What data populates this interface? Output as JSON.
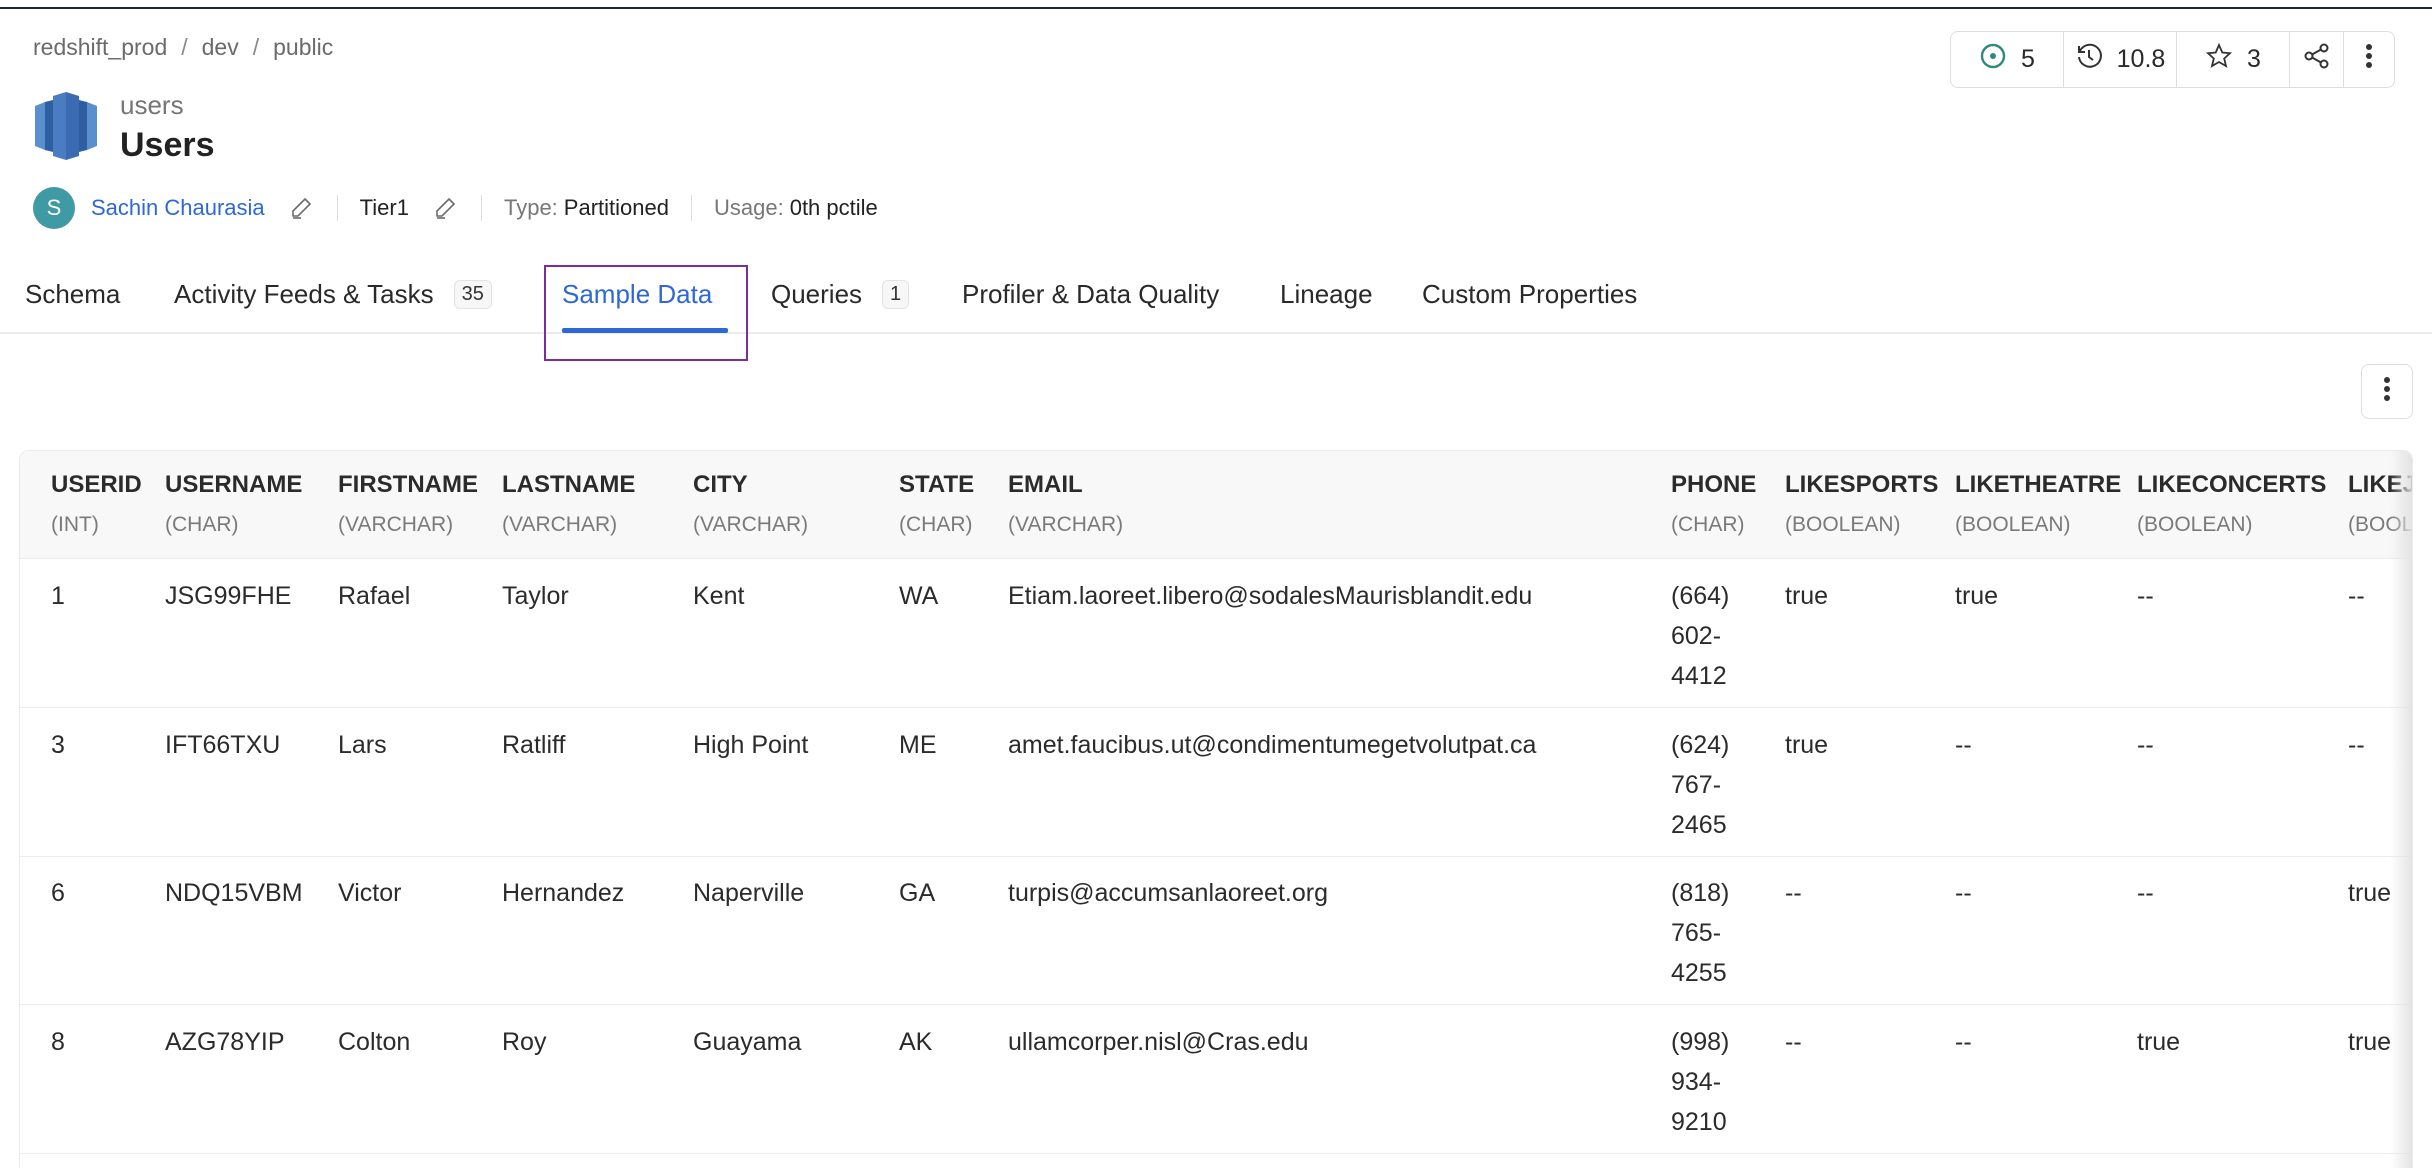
{
  "breadcrumb": [
    "redshift_prod",
    "dev",
    "public"
  ],
  "breadcrumb_separator": "/",
  "entity": {
    "service_icon": "redshift-logo-icon",
    "name": "users",
    "display_name": "Users"
  },
  "meta": {
    "owner_initial": "S",
    "owner_name": "Sachin Chaurasia",
    "tier": "Tier1",
    "type_label": "Type:",
    "type_value": "Partitioned",
    "usage_label": "Usage:",
    "usage_value": "0th pctile"
  },
  "stats": {
    "followers_icon": "radio-dot-icon",
    "followers": "5",
    "version_icon": "history-icon",
    "version": "10.8",
    "stars_icon": "star-icon",
    "stars": "3",
    "share_icon": "share-icon",
    "more_icon": "more-vertical-icon"
  },
  "colors": {
    "accent": "#2d68d6",
    "avatar": "#3f9aa5",
    "highlight": "#7a2d9b",
    "followers_icon": "#2f8a7e"
  },
  "tabs": [
    {
      "label": "Schema"
    },
    {
      "label": "Activity Feeds & Tasks",
      "count": "35"
    },
    {
      "label": "Sample Data",
      "active": true
    },
    {
      "label": "Queries",
      "count": "1"
    },
    {
      "label": "Profiler & Data Quality"
    },
    {
      "label": "Lineage"
    },
    {
      "label": "Custom Properties"
    }
  ],
  "table": {
    "columns": [
      {
        "name": "USERID",
        "type": "(INT)"
      },
      {
        "name": "USERNAME",
        "type": "(CHAR)"
      },
      {
        "name": "FIRSTNAME",
        "type": "(VARCHAR)"
      },
      {
        "name": "LASTNAME",
        "type": "(VARCHAR)"
      },
      {
        "name": "CITY",
        "type": "(VARCHAR)"
      },
      {
        "name": "STATE",
        "type": "(CHAR)"
      },
      {
        "name": "EMAIL",
        "type": "(VARCHAR)"
      },
      {
        "name": "PHONE",
        "type": "(CHAR)"
      },
      {
        "name": "LIKESPORTS",
        "type": "(BOOLEAN)"
      },
      {
        "name": "LIKETHEATRE",
        "type": "(BOOLEAN)"
      },
      {
        "name": "LIKECONCERTS",
        "type": "(BOOLEAN)"
      },
      {
        "name": "LIKEJ",
        "type": "(BOOL"
      }
    ],
    "rows": [
      [
        "1",
        "JSG99FHE",
        "Rafael",
        "Taylor",
        "Kent",
        "WA",
        "Etiam.laoreet.libero@sodalesMaurisblandit.edu",
        "(664) 602-4412",
        "true",
        "true",
        "--",
        "--"
      ],
      [
        "3",
        "IFT66TXU",
        "Lars",
        "Ratliff",
        "High Point",
        "ME",
        "amet.faucibus.ut@condimentumegetvolutpat.ca",
        "(624) 767-2465",
        "true",
        "--",
        "--",
        "--"
      ],
      [
        "6",
        "NDQ15VBM",
        "Victor",
        "Hernandez",
        "Naperville",
        "GA",
        "turpis@accumsanlaoreet.org",
        "(818) 765-4255",
        "--",
        "--",
        "--",
        "true"
      ],
      [
        "8",
        "AZG78YIP",
        "Colton",
        "Roy",
        "Guayama",
        "AK",
        "ullamcorper.nisl@Cras.edu",
        "(998) 934-9210",
        "--",
        "--",
        "true",
        "true"
      ]
    ]
  }
}
